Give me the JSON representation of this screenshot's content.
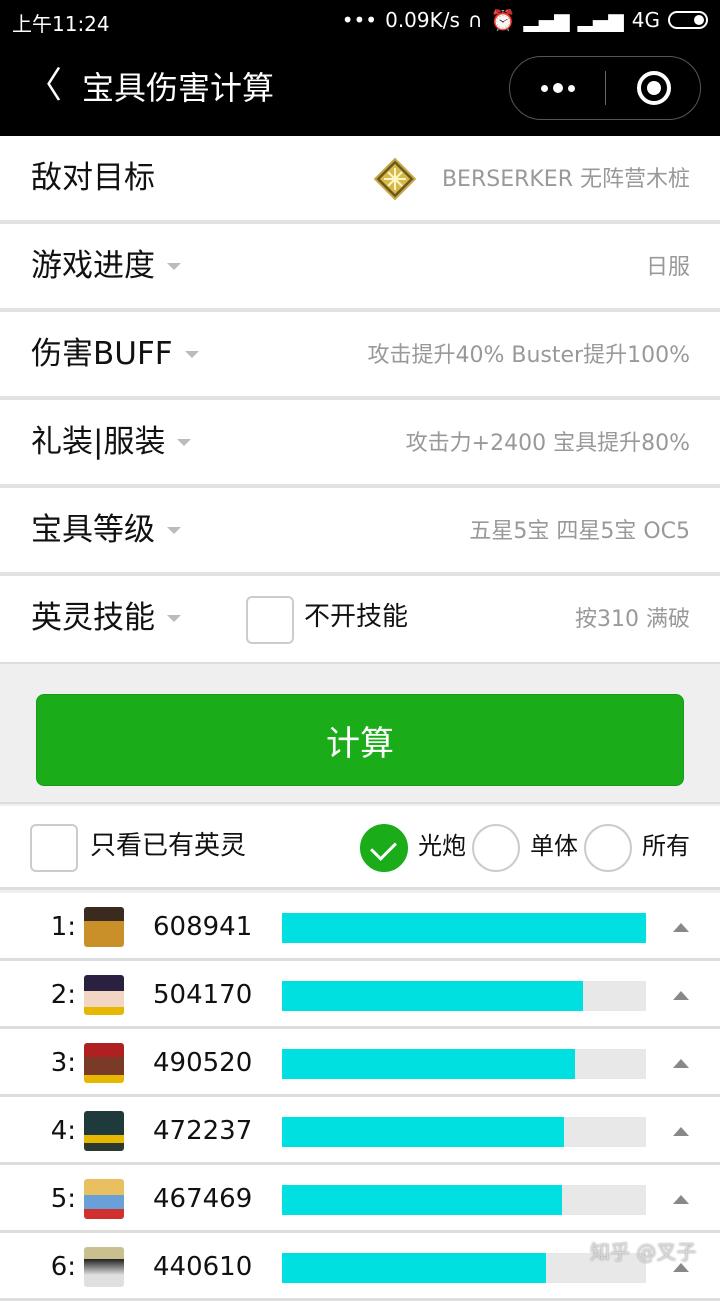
{
  "status_bar": {
    "time": "上午11:24",
    "network_speed": "0.09K/s",
    "network_type": "4G",
    "icons": [
      "more-dots-icon",
      "headphones-icon",
      "alarm-icon",
      "signal-icon",
      "hd-signal-icon",
      "battery-icon"
    ]
  },
  "nav": {
    "back_icon": "chevron-left-icon",
    "back_glyph": "〈",
    "title": "宝具伤害计算"
  },
  "form": {
    "rows": [
      {
        "label": "敌对目标",
        "value": "BERSERKER 无阵营木桩",
        "has_dropdown": false
      },
      {
        "label": "游戏进度",
        "value": "日服",
        "has_dropdown": true
      },
      {
        "label": "伤害BUFF",
        "value": "攻击提升40% Buster提升100%",
        "has_dropdown": true
      },
      {
        "label": "礼装|服装",
        "value": "攻击力+2400 宝具提升80%",
        "has_dropdown": true
      },
      {
        "label": "宝具等级",
        "value": "五星5宝 四星5宝 OC5",
        "has_dropdown": true
      },
      {
        "label": "英灵技能",
        "value": "按310 满破",
        "has_dropdown": true
      }
    ],
    "skill_checkbox_label": "不开技能",
    "skill_checkbox_checked": false
  },
  "calculate_button": "计算",
  "filter": {
    "owned_only_label": "只看已有英灵",
    "owned_only_checked": false,
    "options": [
      {
        "label": "光炮",
        "selected": true
      },
      {
        "label": "单体",
        "selected": false
      },
      {
        "label": "所有",
        "selected": false
      }
    ]
  },
  "results": {
    "accent_color": "#00e0e0",
    "items": [
      {
        "rank": "1:",
        "damage": "608941",
        "fraction": 1.0
      },
      {
        "rank": "2:",
        "damage": "504170",
        "fraction": 0.828
      },
      {
        "rank": "3:",
        "damage": "490520",
        "fraction": 0.806
      },
      {
        "rank": "4:",
        "damage": "472237",
        "fraction": 0.776
      },
      {
        "rank": "5:",
        "damage": "467469",
        "fraction": 0.768
      },
      {
        "rank": "6:",
        "damage": "440610",
        "fraction": 0.724
      }
    ]
  },
  "watermark": "知乎 @叉子"
}
